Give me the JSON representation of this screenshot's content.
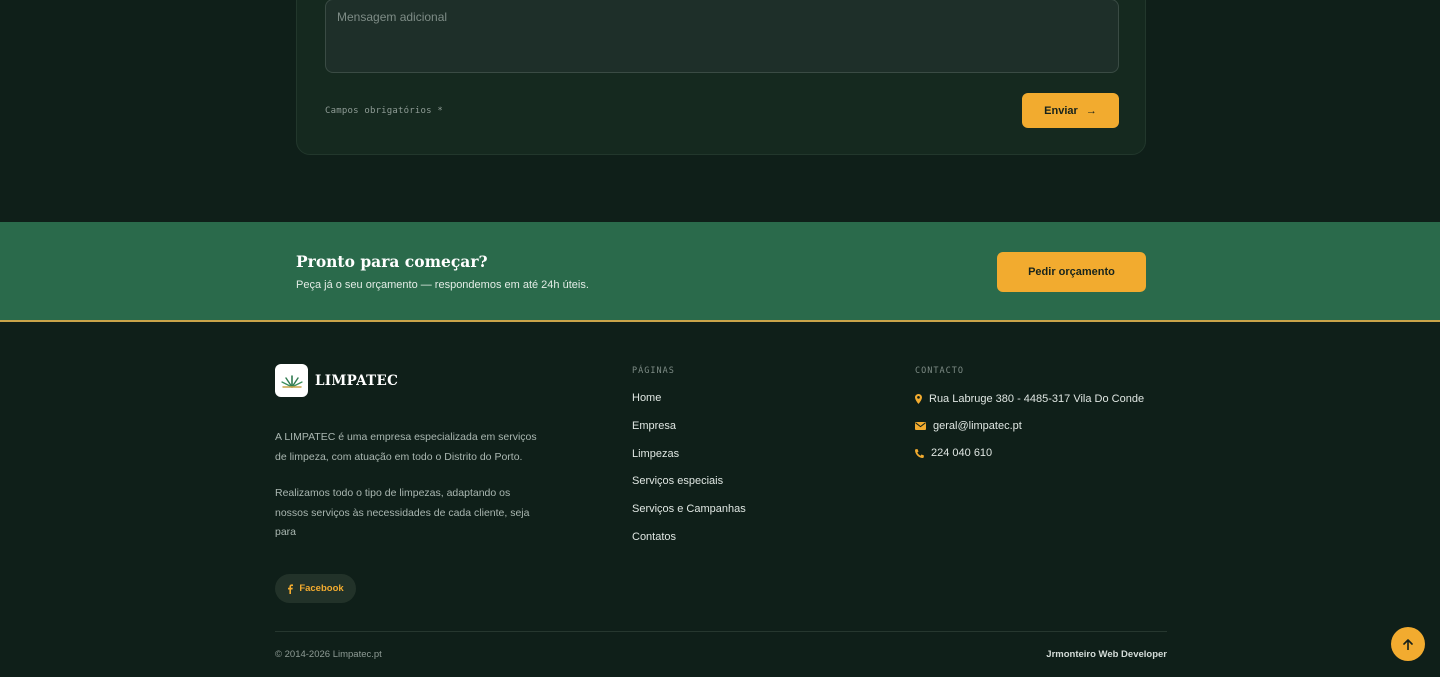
{
  "form": {
    "message_placeholder": "Mensagem adicional",
    "required_note": "Campos obrigatórios *",
    "send_label": "Enviar",
    "send_arrow": "→"
  },
  "cta": {
    "title": "Pronto para começar?",
    "subtitle": "Peça já o seu orçamento — respondemos em até 24h úteis.",
    "button_label": "Pedir orçamento"
  },
  "footer": {
    "brand": "LIMPATEC",
    "about": [
      "A LIMPATEC é uma empresa especializada em serviços de limpeza, com atuação em todo o Distrito do Porto.",
      "Realizamos todo o tipo de limpezas, adaptando os nossos serviços às necessidades de cada cliente, seja para"
    ],
    "facebook_label": "Facebook",
    "pages_heading": "PÁGINAS",
    "pages": [
      "Home",
      "Empresa",
      "Limpezas",
      "Serviços especiais",
      "Serviços e Campanhas",
      "Contatos"
    ],
    "contact_heading": "CONTACTO",
    "contact": {
      "address": "Rua Labruge 380 - 4485-317 Vila Do Conde",
      "email": "geral@limpatec.pt",
      "phone": "224 040 610"
    },
    "copyright": "© 2014-2026 Limpatec.pt",
    "credit": "Jrmonteiro Web Developer"
  },
  "colors": {
    "accent": "#f2ab2f",
    "background": "#0f1f19",
    "cta_band": "#2a6a4b"
  },
  "icons": {
    "address": "map-pin-icon",
    "email": "envelope-icon",
    "phone": "phone-icon",
    "facebook": "facebook-icon",
    "back_to_top": "arrow-up-icon"
  }
}
